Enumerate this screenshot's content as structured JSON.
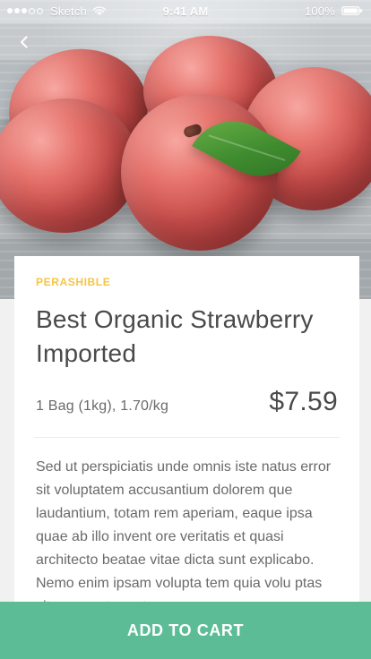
{
  "status_bar": {
    "carrier": "Sketch",
    "time": "9:41 AM",
    "battery_percent": "100%"
  },
  "navigation": {
    "back_icon": "chevron-left-icon"
  },
  "hero": {
    "image_icon": "product-image"
  },
  "product": {
    "category": "PERASHIBLE",
    "title": "Best Organic Strawberry Imported",
    "unit": "1 Bag (1kg), 1.70/kg",
    "price": "$7.59",
    "description": "Sed ut perspiciatis unde omnis iste natus error sit voluptatem accusantium dolorem que laudantium, totam rem aperiam, eaque ipsa quae ab illo invent ore veritatis et quasi architecto beatae vitae dicta sunt explicabo. Nemo enim ipsam volupta tem quia volu ptas sit aspernatur aut"
  },
  "cta": {
    "label": "ADD TO CART"
  },
  "colors": {
    "accent": "#5cbc96",
    "category": "#f5c542",
    "text_primary": "#4a4a4a",
    "text_secondary": "#6a6a6a",
    "background": "#f1f1f1"
  }
}
